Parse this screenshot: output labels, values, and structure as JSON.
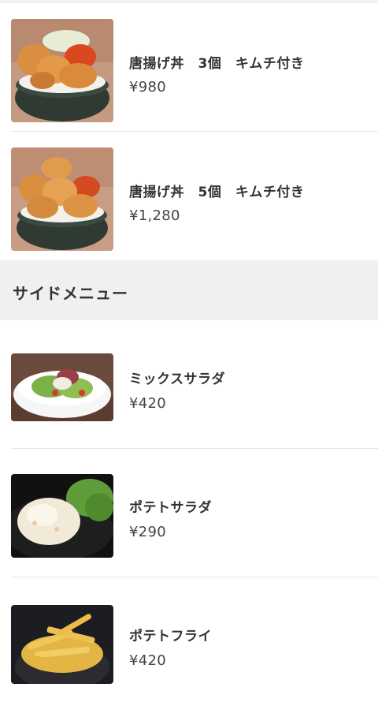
{
  "main_items": [
    {
      "name": "唐揚げ丼　3個　キムチ付き",
      "price": "¥980",
      "image": "karaage-don-bowl-3"
    },
    {
      "name": "唐揚げ丼　5個　キムチ付き",
      "price": "¥1,280",
      "image": "karaage-don-bowl-5"
    }
  ],
  "side_section": {
    "title": "サイドメニュー",
    "items": [
      {
        "name": "ミックスサラダ",
        "price": "¥420",
        "image": "mixed-salad-bowl"
      },
      {
        "name": "ポテトサラダ",
        "price": "¥290",
        "image": "potato-salad-plate"
      },
      {
        "name": "ポテトフライ",
        "price": "¥420",
        "image": "french-fries-bowl"
      }
    ]
  },
  "colors": {
    "section_bg": "#f0f0f0",
    "divider": "#e6e6e6",
    "text": "#333333"
  }
}
